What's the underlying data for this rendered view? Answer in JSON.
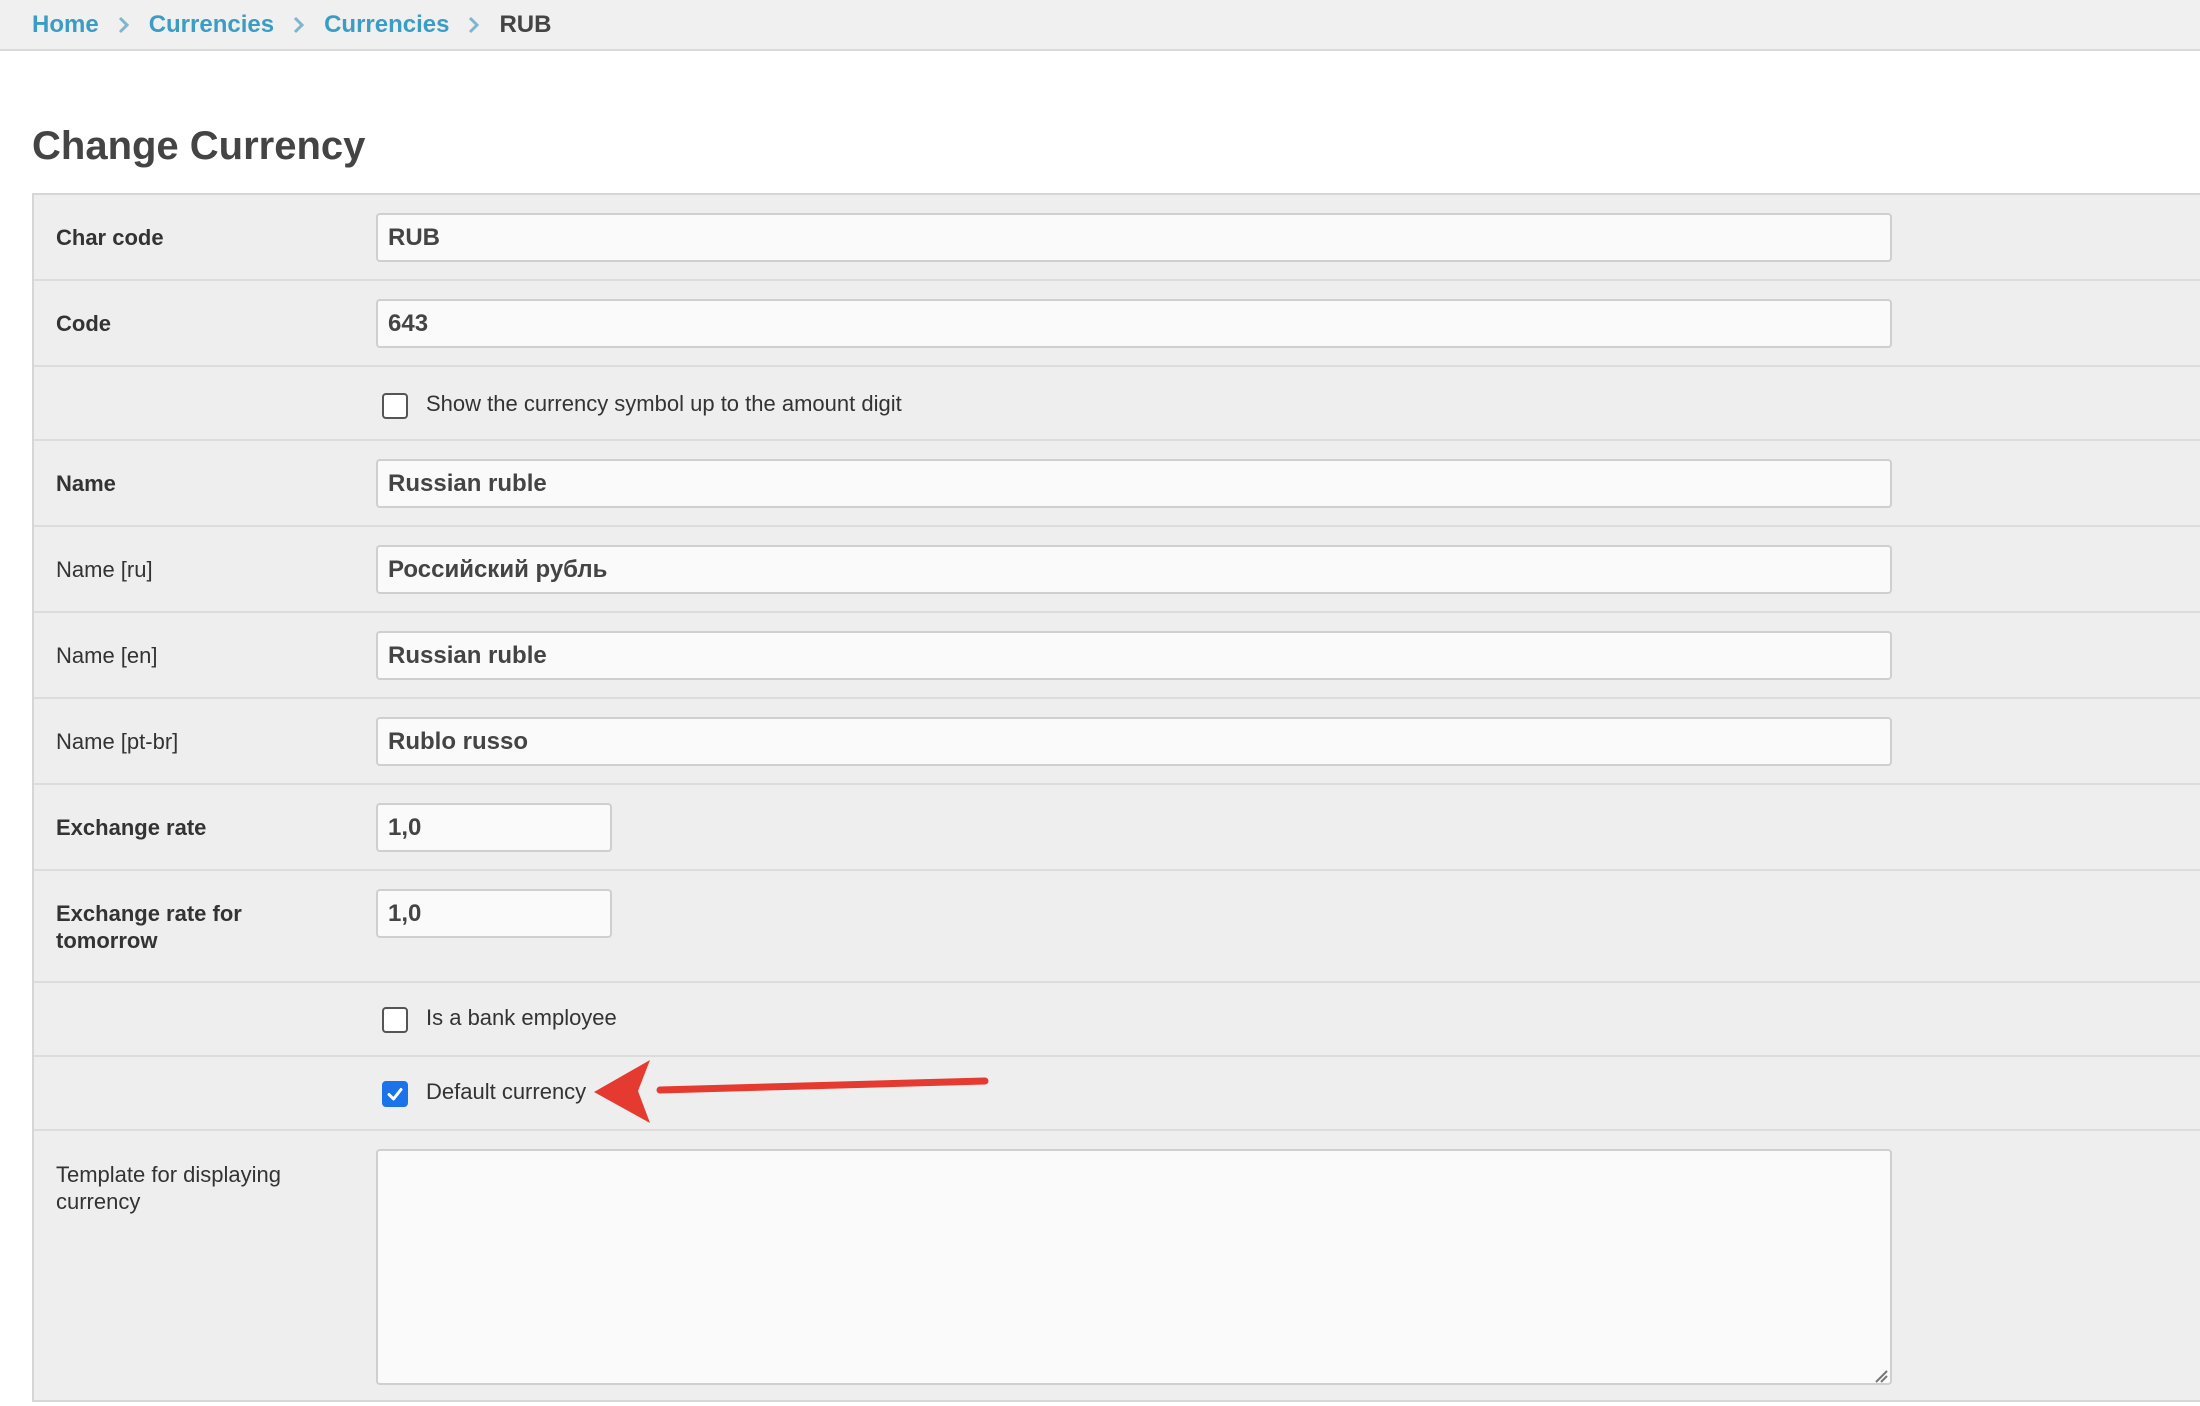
{
  "breadcrumbs": {
    "home": "Home",
    "level1": "Currencies",
    "level2": "Currencies",
    "current": "RUB"
  },
  "page_title": "Change Currency",
  "fields": {
    "char_code": {
      "label": "Char code",
      "value": "RUB"
    },
    "code": {
      "label": "Code",
      "value": "643"
    },
    "show_symbol": {
      "label": "Show the currency symbol up to the amount digit",
      "checked": false
    },
    "name": {
      "label": "Name",
      "value": "Russian ruble"
    },
    "name_ru": {
      "label": "Name [ru]",
      "value": "Российский рубль"
    },
    "name_en": {
      "label": "Name [en]",
      "value": "Russian ruble"
    },
    "name_ptbr": {
      "label": "Name [pt-br]",
      "value": "Rublo russo"
    },
    "exchange_rate": {
      "label": "Exchange rate",
      "value": "1,0"
    },
    "exchange_rate_tomorrow": {
      "label_line1": "Exchange rate for",
      "label_line2": "tomorrow",
      "value": "1,0"
    },
    "bank_employee": {
      "label": "Is a bank employee",
      "checked": false
    },
    "default_currency": {
      "label": "Default currency",
      "checked": true
    },
    "template": {
      "label_line1": "Template for displaying",
      "label_line2": "currency",
      "value": ""
    }
  },
  "colors": {
    "link": "#3b9dc4",
    "checkbox_on": "#1a73e8",
    "annotation_arrow": "#e53a30"
  },
  "icons": {
    "breadcrumb_separator": "chevron-right-icon",
    "checkmark": "check-icon",
    "annotation": "red-arrow-icon"
  }
}
